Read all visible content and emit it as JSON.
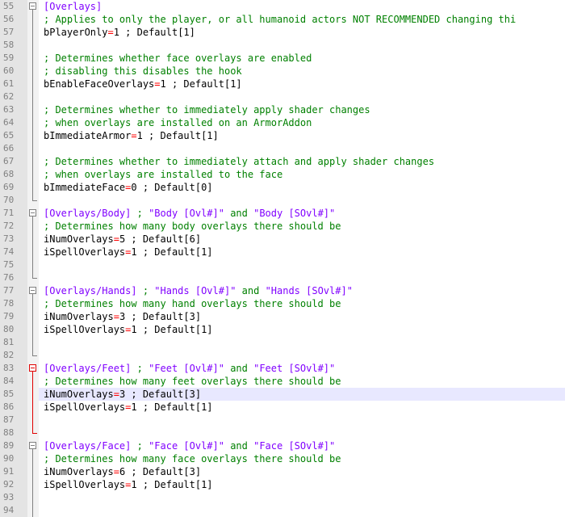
{
  "lines": [
    {
      "num": "55",
      "fold": "box-blue",
      "parts": [
        {
          "cls": "section",
          "text": "[Overlays]"
        }
      ]
    },
    {
      "num": "56",
      "fold": "line",
      "parts": [
        {
          "cls": "comment",
          "text": "; Applies to only the player, or all humanoid actors NOT RECOMMENDED changing thi"
        }
      ]
    },
    {
      "num": "57",
      "fold": "line",
      "parts": [
        {
          "cls": "key",
          "text": "bPlayerOnly"
        },
        {
          "cls": "eq",
          "text": "="
        },
        {
          "cls": "value",
          "text": "1 ; Default[1]"
        }
      ]
    },
    {
      "num": "58",
      "fold": "line",
      "parts": []
    },
    {
      "num": "59",
      "fold": "line",
      "parts": [
        {
          "cls": "comment",
          "text": "; Determines whether face overlays are enabled"
        }
      ]
    },
    {
      "num": "60",
      "fold": "line",
      "parts": [
        {
          "cls": "comment",
          "text": "; disabling this disables the hook"
        }
      ]
    },
    {
      "num": "61",
      "fold": "line",
      "parts": [
        {
          "cls": "key",
          "text": "bEnableFaceOverlays"
        },
        {
          "cls": "eq",
          "text": "="
        },
        {
          "cls": "value",
          "text": "1 ; Default[1]"
        }
      ]
    },
    {
      "num": "62",
      "fold": "line",
      "parts": []
    },
    {
      "num": "63",
      "fold": "line",
      "parts": [
        {
          "cls": "comment",
          "text": "; Determines whether to immediately apply shader changes"
        }
      ]
    },
    {
      "num": "64",
      "fold": "line",
      "parts": [
        {
          "cls": "comment",
          "text": "; when overlays are installed on an ArmorAddon"
        }
      ]
    },
    {
      "num": "65",
      "fold": "line",
      "parts": [
        {
          "cls": "key",
          "text": "bImmediateArmor"
        },
        {
          "cls": "eq",
          "text": "="
        },
        {
          "cls": "value",
          "text": "1 ; Default[1]"
        }
      ]
    },
    {
      "num": "66",
      "fold": "line",
      "parts": []
    },
    {
      "num": "67",
      "fold": "line",
      "parts": [
        {
          "cls": "comment",
          "text": "; Determines whether to immediately attach and apply shader changes"
        }
      ]
    },
    {
      "num": "68",
      "fold": "line",
      "parts": [
        {
          "cls": "comment",
          "text": "; when overlays are installed to the face"
        }
      ]
    },
    {
      "num": "69",
      "fold": "line",
      "parts": [
        {
          "cls": "key",
          "text": "bImmediateFace"
        },
        {
          "cls": "eq",
          "text": "="
        },
        {
          "cls": "value",
          "text": "0 ; Default[0]"
        }
      ]
    },
    {
      "num": "70",
      "fold": "end",
      "parts": []
    },
    {
      "num": "71",
      "fold": "box",
      "parts": [
        {
          "cls": "section",
          "text": "[Overlays/Body]"
        },
        {
          "cls": "comment",
          "text": " ; "
        },
        {
          "cls": "section",
          "text": "\"Body [Ovl#]\""
        },
        {
          "cls": "comment",
          "text": " and "
        },
        {
          "cls": "section",
          "text": "\"Body [SOvl#]\""
        }
      ]
    },
    {
      "num": "72",
      "fold": "line",
      "parts": [
        {
          "cls": "comment",
          "text": "; Determines how many body overlays there should be"
        }
      ]
    },
    {
      "num": "73",
      "fold": "line",
      "parts": [
        {
          "cls": "key",
          "text": "iNumOverlays"
        },
        {
          "cls": "eq",
          "text": "="
        },
        {
          "cls": "value",
          "text": "5 ; Default[6]"
        }
      ]
    },
    {
      "num": "74",
      "fold": "line",
      "parts": [
        {
          "cls": "key",
          "text": "iSpellOverlays"
        },
        {
          "cls": "eq",
          "text": "="
        },
        {
          "cls": "value",
          "text": "1 ; Default[1]"
        }
      ]
    },
    {
      "num": "75",
      "fold": "line",
      "parts": []
    },
    {
      "num": "76",
      "fold": "end",
      "parts": []
    },
    {
      "num": "77",
      "fold": "box",
      "parts": [
        {
          "cls": "section",
          "text": "[Overlays/Hands]"
        },
        {
          "cls": "comment",
          "text": " ; "
        },
        {
          "cls": "section",
          "text": "\"Hands [Ovl#]\""
        },
        {
          "cls": "comment",
          "text": " and "
        },
        {
          "cls": "section",
          "text": "\"Hands [SOvl#]\""
        }
      ]
    },
    {
      "num": "78",
      "fold": "line",
      "parts": [
        {
          "cls": "comment",
          "text": "; Determines how many hand overlays there should be"
        }
      ]
    },
    {
      "num": "79",
      "fold": "line",
      "parts": [
        {
          "cls": "key",
          "text": "iNumOverlays"
        },
        {
          "cls": "eq",
          "text": "="
        },
        {
          "cls": "value",
          "text": "3 ; Default[3]"
        }
      ]
    },
    {
      "num": "80",
      "fold": "line",
      "parts": [
        {
          "cls": "key",
          "text": "iSpellOverlays"
        },
        {
          "cls": "eq",
          "text": "="
        },
        {
          "cls": "value",
          "text": "1 ; Default[1]"
        }
      ]
    },
    {
      "num": "81",
      "fold": "line",
      "parts": []
    },
    {
      "num": "82",
      "fold": "end",
      "parts": []
    },
    {
      "num": "83",
      "fold": "box-red",
      "parts": [
        {
          "cls": "section",
          "text": "[Overlays/Feet]"
        },
        {
          "cls": "comment",
          "text": " ; "
        },
        {
          "cls": "section",
          "text": "\"Feet [Ovl#]\""
        },
        {
          "cls": "comment",
          "text": " and "
        },
        {
          "cls": "section",
          "text": "\"Feet [SOvl#]\""
        }
      ]
    },
    {
      "num": "84",
      "fold": "line-red",
      "parts": [
        {
          "cls": "comment",
          "text": "; Determines how many feet overlays there should be"
        }
      ]
    },
    {
      "num": "85",
      "fold": "line-red",
      "highlight": true,
      "parts": [
        {
          "cls": "key",
          "text": "iNumOverlays"
        },
        {
          "cls": "eq",
          "text": "="
        },
        {
          "cls": "value",
          "text": "3 ; Default[3]"
        }
      ]
    },
    {
      "num": "86",
      "fold": "line-red",
      "parts": [
        {
          "cls": "key",
          "text": "iSpellOverlays"
        },
        {
          "cls": "eq",
          "text": "="
        },
        {
          "cls": "value",
          "text": "1 ; Default[1]"
        }
      ]
    },
    {
      "num": "87",
      "fold": "line-red",
      "parts": []
    },
    {
      "num": "88",
      "fold": "end-red",
      "parts": []
    },
    {
      "num": "89",
      "fold": "box",
      "parts": [
        {
          "cls": "section",
          "text": "[Overlays/Face]"
        },
        {
          "cls": "comment",
          "text": " ; "
        },
        {
          "cls": "section",
          "text": "\"Face [Ovl#]\""
        },
        {
          "cls": "comment",
          "text": " and "
        },
        {
          "cls": "section",
          "text": "\"Face [SOvl#]\""
        }
      ]
    },
    {
      "num": "90",
      "fold": "line",
      "parts": [
        {
          "cls": "comment",
          "text": "; Determines how many face overlays there should be"
        }
      ]
    },
    {
      "num": "91",
      "fold": "line",
      "parts": [
        {
          "cls": "key",
          "text": "iNumOverlays"
        },
        {
          "cls": "eq",
          "text": "="
        },
        {
          "cls": "value",
          "text": "6 ; Default[3]"
        }
      ]
    },
    {
      "num": "92",
      "fold": "line",
      "parts": [
        {
          "cls": "key",
          "text": "iSpellOverlays"
        },
        {
          "cls": "eq",
          "text": "="
        },
        {
          "cls": "value",
          "text": "1 ; Default[1]"
        }
      ]
    },
    {
      "num": "93",
      "fold": "line",
      "parts": []
    },
    {
      "num": "94",
      "fold": "line",
      "parts": []
    }
  ],
  "colors": {
    "section": "#8000ff",
    "comment": "#008000",
    "operator": "#ff0000",
    "gutter_bg": "#e4e4e4",
    "line_number": "#808080",
    "current_line": "#e8e8ff",
    "fold_active": "#e00000"
  }
}
